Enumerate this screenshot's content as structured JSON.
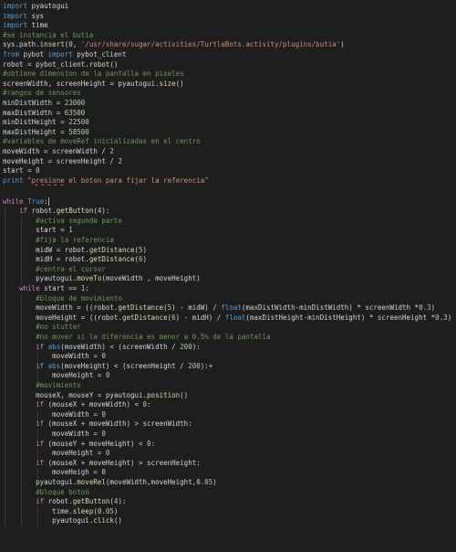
{
  "code": {
    "lines": [
      "import pyautogui",
      "import sys",
      "import time",
      "#se instancia el butia",
      "sys.path.insert(0, '/usr/share/sugar/activities/TurtleBots.activity/plugins/butia')",
      "from pybot import pybot_client",
      "robot = pybot_client.robot()",
      "#obtiene dimension de la pantalla en pixeles",
      "screenWidth, screenHeight = pyautogui.size()",
      "#rangos de sensores",
      "minDistWidth = 23000",
      "maxDistWidth = 63500",
      "minDistHeight = 22500",
      "maxDistHeight = 58500",
      "#variables de moveRef inicializadas en el centro",
      "moveWidth = screenWidth / 2",
      "moveHeight = screenHeight / 2",
      "start = 0",
      "print \"presione el boton para fijar la referencia\"",
      "",
      "while True:",
      "    if robot.getButton(4):",
      "        #activa segunda parte",
      "        start = 1",
      "        #fija la referencia",
      "        midW = robot.getDistance(5)",
      "        midH = robot.getDistance(6)",
      "        #centra el cursor",
      "        pyautogui.moveTo(moveWidth , moveHeight)",
      "    while start == 1:",
      "        #bloque de movimiento",
      "        moveWidth = ((robot.getDistance(5) - midW) / float(maxDistWidth-minDistWidth) * screenWidth *0.3)",
      "        moveHeight = ((robot.getDistance(6) - midH) / float(maxDistHeight-minDistHeight) * screenHeight *0.3)",
      "        #no stutter",
      "        #no mover si la diferencia es menor a 0.5% de la pantalla",
      "        if abs(moveWidth) < (screenWidth / 200):",
      "            moveWidth = 0",
      "        if abs(moveHeight) < (screenHeight / 200):+",
      "            moveHeight = 0",
      "        #movimiento",
      "        mouseX, mouseY = pyautogui.position()",
      "        if (mouseX + moveWidth) < 0:",
      "            moveWidth = 0",
      "        if (mouseX + moveWidth) > screenWidth:",
      "            moveWidth = 0",
      "        if (mouseY + moveHeight) < 0:",
      "            moveHeight = 0",
      "        if (mouseX + moveHeight) > screenHeight:",
      "            moveHeigh = 0",
      "        pyautogui.moveRel(moveWidth,moveHeight,0.05)",
      "        #bloque boton",
      "        if robot.getButton(4):",
      "            time.sleep(0.05)",
      "            pyautogui.click()"
    ]
  },
  "colors": {
    "background": "#1e1e1e",
    "text": "#d4d4d4",
    "keyword": "#569cd6",
    "control": "#c586c0",
    "function": "#dcdcaa",
    "string": "#ce9178",
    "number": "#b5cea8",
    "comment": "#6a9955"
  }
}
